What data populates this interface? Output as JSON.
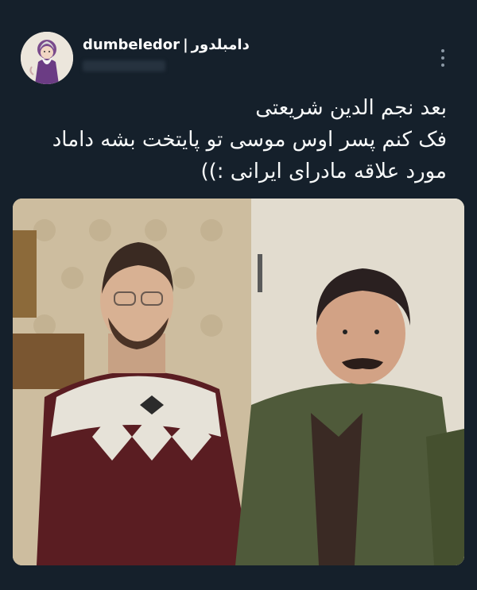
{
  "author": {
    "display_name": "dumbeledor",
    "separator": "|",
    "display_name_fa": "دامبلدور",
    "avatar_icon": "wizard-avatar-icon"
  },
  "tweet": {
    "lines": [
      "بعد نجم الدین شریعتی",
      "فک کنم پسر اوس موسی تو پایتخت بشه داماد",
      "مورد علاقه مادرای ایرانی :))"
    ]
  },
  "media": {
    "description_icon": "photo-two-men-icon"
  },
  "colors": {
    "background": "#15202b",
    "text": "#f7f9f9",
    "muted": "#8b98a5"
  }
}
